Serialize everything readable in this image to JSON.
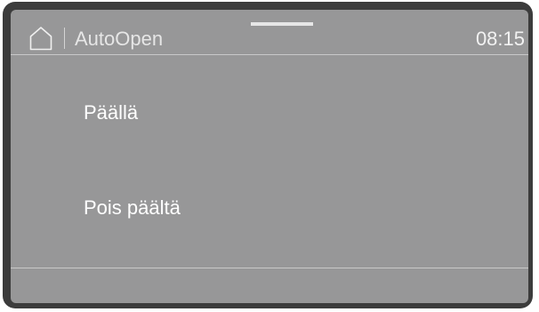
{
  "header": {
    "home_icon": "home-icon",
    "title": "AutoOpen",
    "time": "08:15"
  },
  "options": [
    {
      "label": "Päällä"
    },
    {
      "label": "Pois päältä"
    }
  ],
  "colors": {
    "bezel": "#3c3c3c",
    "screen": "#979798",
    "text": "#ffffff",
    "rule": "#c9c9c9"
  }
}
